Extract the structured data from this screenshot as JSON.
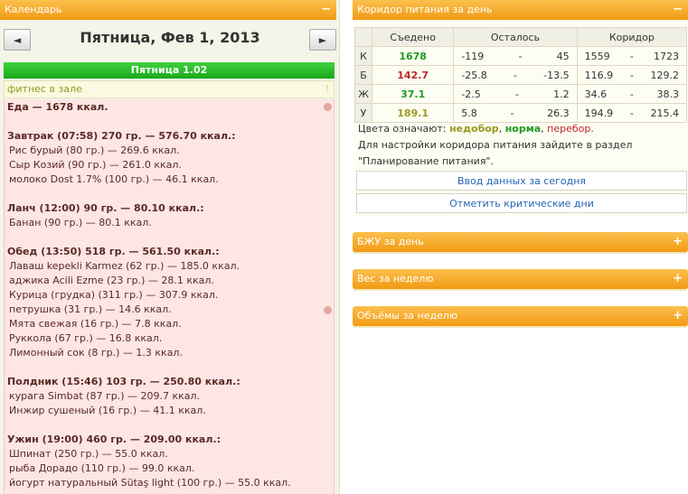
{
  "calendar": {
    "title": "Календарь",
    "toggle": "−",
    "prev": "◄",
    "next": "►",
    "date": "Пятница, Фев 1, 2013",
    "day_label": "Пятница 1.02",
    "training": "фитнес в зале",
    "training_mark": "!"
  },
  "food": {
    "total": "Еда — 1678 ккал.",
    "meals": [
      {
        "title": "Завтрак (07:58) 270 гр. — 576.70 ккал.:",
        "items": [
          "Рис бурый (80 гр.) — 269.6 ккал.",
          "Сыр Козий (90 гр.) — 261.0 ккал.",
          "молоко Dost 1.7% (100 гр.) — 46.1 ккал."
        ]
      },
      {
        "title": "Ланч (12:00) 90 гр. — 80.10 ккал.:",
        "items": [
          "Банан (90 гр.) — 80.1 ккал."
        ]
      },
      {
        "title": "Обед (13:50) 518 гр. — 561.50 ккал.:",
        "items": [
          "Лаваш kepekli Karmez (62 гр.) — 185.0 ккал.",
          "аджика Acili Ezme (23 гр.) — 28.1 ккал.",
          "Курица (грудка) (311 гр.) — 307.9 ккал.",
          "петрушка (31 гр.) — 14.6 ккал.",
          "Мята свежая (16 гр.) — 7.8 ккал.",
          "Руккола (67 гр.) — 16.8 ккал.",
          "Лимонный сок (8 гр.) — 1.3 ккал."
        ]
      },
      {
        "title": "Полдник (15:46) 103 гр. — 250.80 ккал.:",
        "items": [
          "курага Simbat (87 гр.) — 209.7 ккал.",
          "Инжир сушеный (16 гр.) — 41.1 ккал."
        ]
      },
      {
        "title": "Ужин (19:00) 460 гр. — 209.00 ккал.:",
        "items": [
          "Шпинат (250 гр.) — 55.0 ккал.",
          "рыба Дорадо (110 гр.) — 99.0 ккал.",
          "йогурт натуральный Sütaş light (100 гр.) — 55.0 ккал."
        ]
      }
    ]
  },
  "corridor": {
    "title": "Коридор питания за день",
    "toggle": "−",
    "headers": [
      "Съедено",
      "Осталось",
      "Коридор"
    ],
    "dash": "-",
    "rows": [
      {
        "label": "К",
        "eaten": "1678",
        "eaten_color": "#1f9a1f",
        "rem_min": "-119",
        "rem_max": "45",
        "cor_min": "1559",
        "cor_max": "1723"
      },
      {
        "label": "Б",
        "eaten": "142.7",
        "eaten_color": "#c0252b",
        "rem_min": "-25.8",
        "rem_max": "-13.5",
        "cor_min": "116.9",
        "cor_max": "129.2"
      },
      {
        "label": "Ж",
        "eaten": "37.1",
        "eaten_color": "#1f9a1f",
        "rem_min": "-2.5",
        "rem_max": "1.2",
        "cor_min": "34.6",
        "cor_max": "38.3"
      },
      {
        "label": "У",
        "eaten": "189.1",
        "eaten_color": "#9a9a20",
        "rem_min": "5.8",
        "rem_max": "26.3",
        "cor_min": "194.9",
        "cor_max": "215.4"
      }
    ],
    "legend_prefix": "Цвета означают:",
    "legend_under": "недобор",
    "legend_sep1": ",",
    "legend_norm": "норма",
    "legend_sep2": ",",
    "legend_over": "перебор",
    "legend_end": ".",
    "note_line1": "Для настройки коридора питания зайдите в раздел",
    "note_line2": "\"Планирование питания\".",
    "btn_enter": "Ввод данных за сегодня",
    "btn_critical": "Отметить критические дни"
  },
  "panels": [
    {
      "title": "БЖУ за день",
      "toggle": "+"
    },
    {
      "title": "Вес за неделю",
      "toggle": "+"
    },
    {
      "title": "Объёмы за неделю",
      "toggle": "+"
    }
  ]
}
